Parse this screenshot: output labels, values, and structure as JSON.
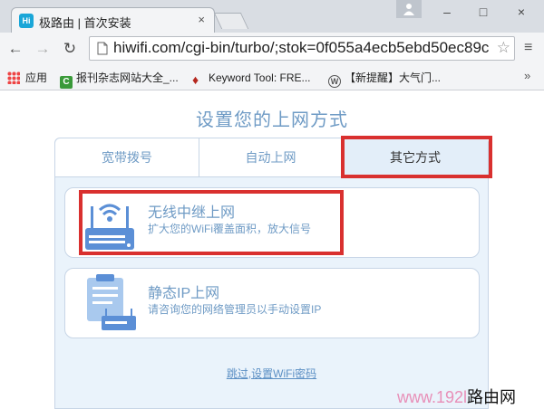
{
  "browser": {
    "tab_title": "极路由 | 首次安装",
    "tab_favicon": "Hi",
    "tab_close": "×",
    "window_controls": {
      "minimize": "–",
      "maximize": "□",
      "close": "×"
    },
    "url": "hiwifi.com/cgi-bin/turbo/;stok=0f055a4ecb5ebd50ec89c",
    "bookmarks": [
      {
        "label": "应用",
        "icon": "apps-grid-icon"
      },
      {
        "label": "报刊杂志网站大全_...",
        "icon": "green-c-icon"
      },
      {
        "label": "Keyword Tool: FRE...",
        "icon": "flame-icon"
      },
      {
        "label": "【新提醒】大气门...",
        "icon": "wordpress-icon"
      }
    ],
    "bookmarks_more": "»"
  },
  "page": {
    "title": "设置您的上网方式",
    "tabs": [
      {
        "label": "宽带拨号"
      },
      {
        "label": "自动上网"
      },
      {
        "label": "其它方式"
      }
    ],
    "options": [
      {
        "title": "无线中继上网",
        "desc": "扩大您的WiFi覆盖面积，放大信号",
        "icon": "wireless-repeater-router-icon"
      },
      {
        "title": "静态IP上网",
        "desc": "请咨询您的网络管理员以手动设置IP",
        "icon": "static-ip-clipboard-router-icon"
      }
    ],
    "skip_link": "跳过,设置WiFi密码"
  },
  "watermark": {
    "latin": "www.192l",
    "cn": "路由网"
  },
  "colors": {
    "accent": "#6f9bc5",
    "highlight": "#d9302f",
    "card_bg": "#eaf3fb"
  }
}
